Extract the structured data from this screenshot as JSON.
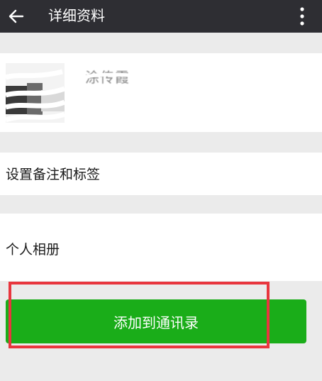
{
  "header": {
    "title": "详细资料",
    "back_icon": "arrow-left-icon",
    "more_icon": "more-vertical-icon"
  },
  "profile": {
    "nickname": "涂传霞",
    "avatar_icon": "avatar"
  },
  "menu": {
    "remark_tags_label": "设置备注和标签",
    "album_label": "个人相册"
  },
  "actions": {
    "add_contact_label": "添加到通讯录"
  },
  "colors": {
    "topbar": "#2e2e33",
    "button_green": "#1aad19",
    "highlight_red": "#e8363e",
    "background": "#ebebeb"
  }
}
